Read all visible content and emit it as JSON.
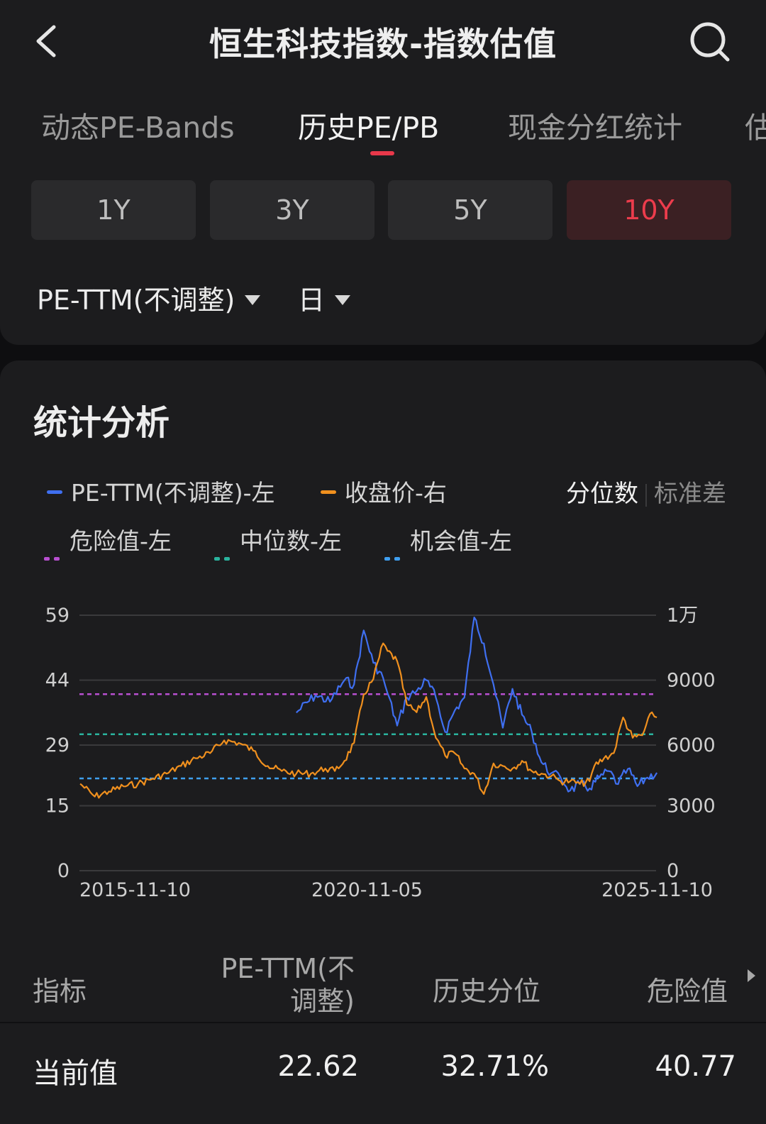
{
  "header": {
    "title": "恒生科技指数-指数估值"
  },
  "tabs": [
    {
      "label": "动态PE-Bands"
    },
    {
      "label": "历史PE/PB"
    },
    {
      "label": "现金分红统计"
    },
    {
      "label": "估"
    }
  ],
  "active_tab": "历史PE/PB",
  "ranges": [
    {
      "label": "1Y"
    },
    {
      "label": "3Y"
    },
    {
      "label": "5Y"
    },
    {
      "label": "10Y"
    }
  ],
  "active_range": "10Y",
  "selectors": {
    "metric": "PE-TTM(不调整)",
    "period": "日"
  },
  "stats": {
    "title": "统计分析",
    "mode_percentile": "分位数",
    "mode_stddev": "标准差",
    "active_mode": "分位数"
  },
  "legend": [
    {
      "label": "PE-TTM(不调整)-左",
      "color": "#3f6ff0",
      "style": "solid"
    },
    {
      "label": "收盘价-右",
      "color": "#f0901e",
      "style": "solid"
    },
    {
      "label": "危险值-左",
      "color": "#b84fd0",
      "style": "dotted"
    },
    {
      "label": "中位数-左",
      "color": "#2ab39e",
      "style": "dotted"
    },
    {
      "label": "机会值-左",
      "color": "#3f9ff0",
      "style": "dotted"
    }
  ],
  "chart_data": {
    "type": "line",
    "x_tick_labels": [
      "2015-11-10",
      "2020-11-05",
      "2025-11-10"
    ],
    "y_left_ticks": [
      "59",
      "44",
      "29",
      "15",
      "0"
    ],
    "y_right_ticks": [
      "1万",
      "9000",
      "6000",
      "3000",
      "0"
    ],
    "y_left_range": [
      0,
      59
    ],
    "y_right_range": [
      0,
      10000
    ],
    "grid": true,
    "reference_lines": {
      "danger": 40.77,
      "median": 31.5,
      "opportunity": 21.3
    },
    "series": [
      {
        "name": "PE-TTM(不调整)-左",
        "axis": "left",
        "x": [
          "2019-08",
          "2019-12",
          "2020-03",
          "2020-06",
          "2020-08",
          "2020-10",
          "2020-12",
          "2021-02",
          "2021-03",
          "2021-05",
          "2021-07",
          "2021-09",
          "2021-11",
          "2022-01",
          "2022-03",
          "2022-05",
          "2022-07",
          "2022-09",
          "2022-11",
          "2023-01",
          "2023-03",
          "2023-05",
          "2023-07",
          "2023-09",
          "2023-11",
          "2024-01",
          "2024-03",
          "2024-05",
          "2024-07",
          "2024-09",
          "2024-11",
          "2025-01",
          "2025-03",
          "2025-05",
          "2025-07",
          "2025-09",
          "2025-11"
        ],
        "values": [
          36.5,
          40.5,
          39.0,
          44.0,
          43.0,
          55.5,
          48.0,
          44.5,
          41.0,
          33.5,
          40.0,
          41.5,
          44.0,
          40.0,
          32.0,
          37.0,
          40.0,
          58.5,
          52.5,
          43.0,
          33.0,
          42.0,
          36.0,
          32.0,
          25.0,
          22.5,
          21.5,
          18.5,
          20.0,
          19.0,
          21.5,
          23.0,
          20.0,
          23.5,
          19.5,
          21.5,
          22.62
        ]
      },
      {
        "name": "收盘价-右",
        "axis": "right",
        "x": [
          "2015-11",
          "2016-02",
          "2016-05",
          "2016-08",
          "2016-11",
          "2017-02",
          "2017-05",
          "2017-08",
          "2017-11",
          "2018-02",
          "2018-05",
          "2018-08",
          "2018-11",
          "2019-02",
          "2019-05",
          "2019-08",
          "2019-11",
          "2020-02",
          "2020-04",
          "2020-06",
          "2020-08",
          "2020-10",
          "2020-12",
          "2021-02",
          "2021-03",
          "2021-05",
          "2021-07",
          "2021-09",
          "2021-11",
          "2022-01",
          "2022-03",
          "2022-05",
          "2022-07",
          "2022-09",
          "2022-11",
          "2023-01",
          "2023-03",
          "2023-05",
          "2023-07",
          "2023-09",
          "2023-11",
          "2024-01",
          "2024-03",
          "2024-05",
          "2024-07",
          "2024-09",
          "2024-10",
          "2024-12",
          "2025-02",
          "2025-04",
          "2025-06",
          "2025-08",
          "2025-10",
          "2025-11"
        ],
        "values": [
          3400,
          2900,
          3100,
          3300,
          3400,
          3600,
          3800,
          4100,
          4400,
          4600,
          5100,
          5000,
          4700,
          4100,
          3900,
          3800,
          3800,
          4000,
          3900,
          4300,
          5000,
          6900,
          7500,
          8900,
          8600,
          8200,
          6500,
          6200,
          6800,
          5200,
          4500,
          4600,
          4000,
          3800,
          3000,
          4200,
          4100,
          4000,
          4300,
          3900,
          3800,
          3700,
          3500,
          3500,
          3400,
          3500,
          4100,
          4400,
          4600,
          6000,
          5200,
          5300,
          6200,
          6000
        ]
      }
    ]
  },
  "table": {
    "headers": [
      "指标",
      "PE-TTM(不调整)",
      "历史分位",
      "危险值"
    ],
    "rows": [
      {
        "label": "当前值",
        "pe": "22.62",
        "percentile": "32.71%",
        "danger": "40.77"
      }
    ]
  }
}
